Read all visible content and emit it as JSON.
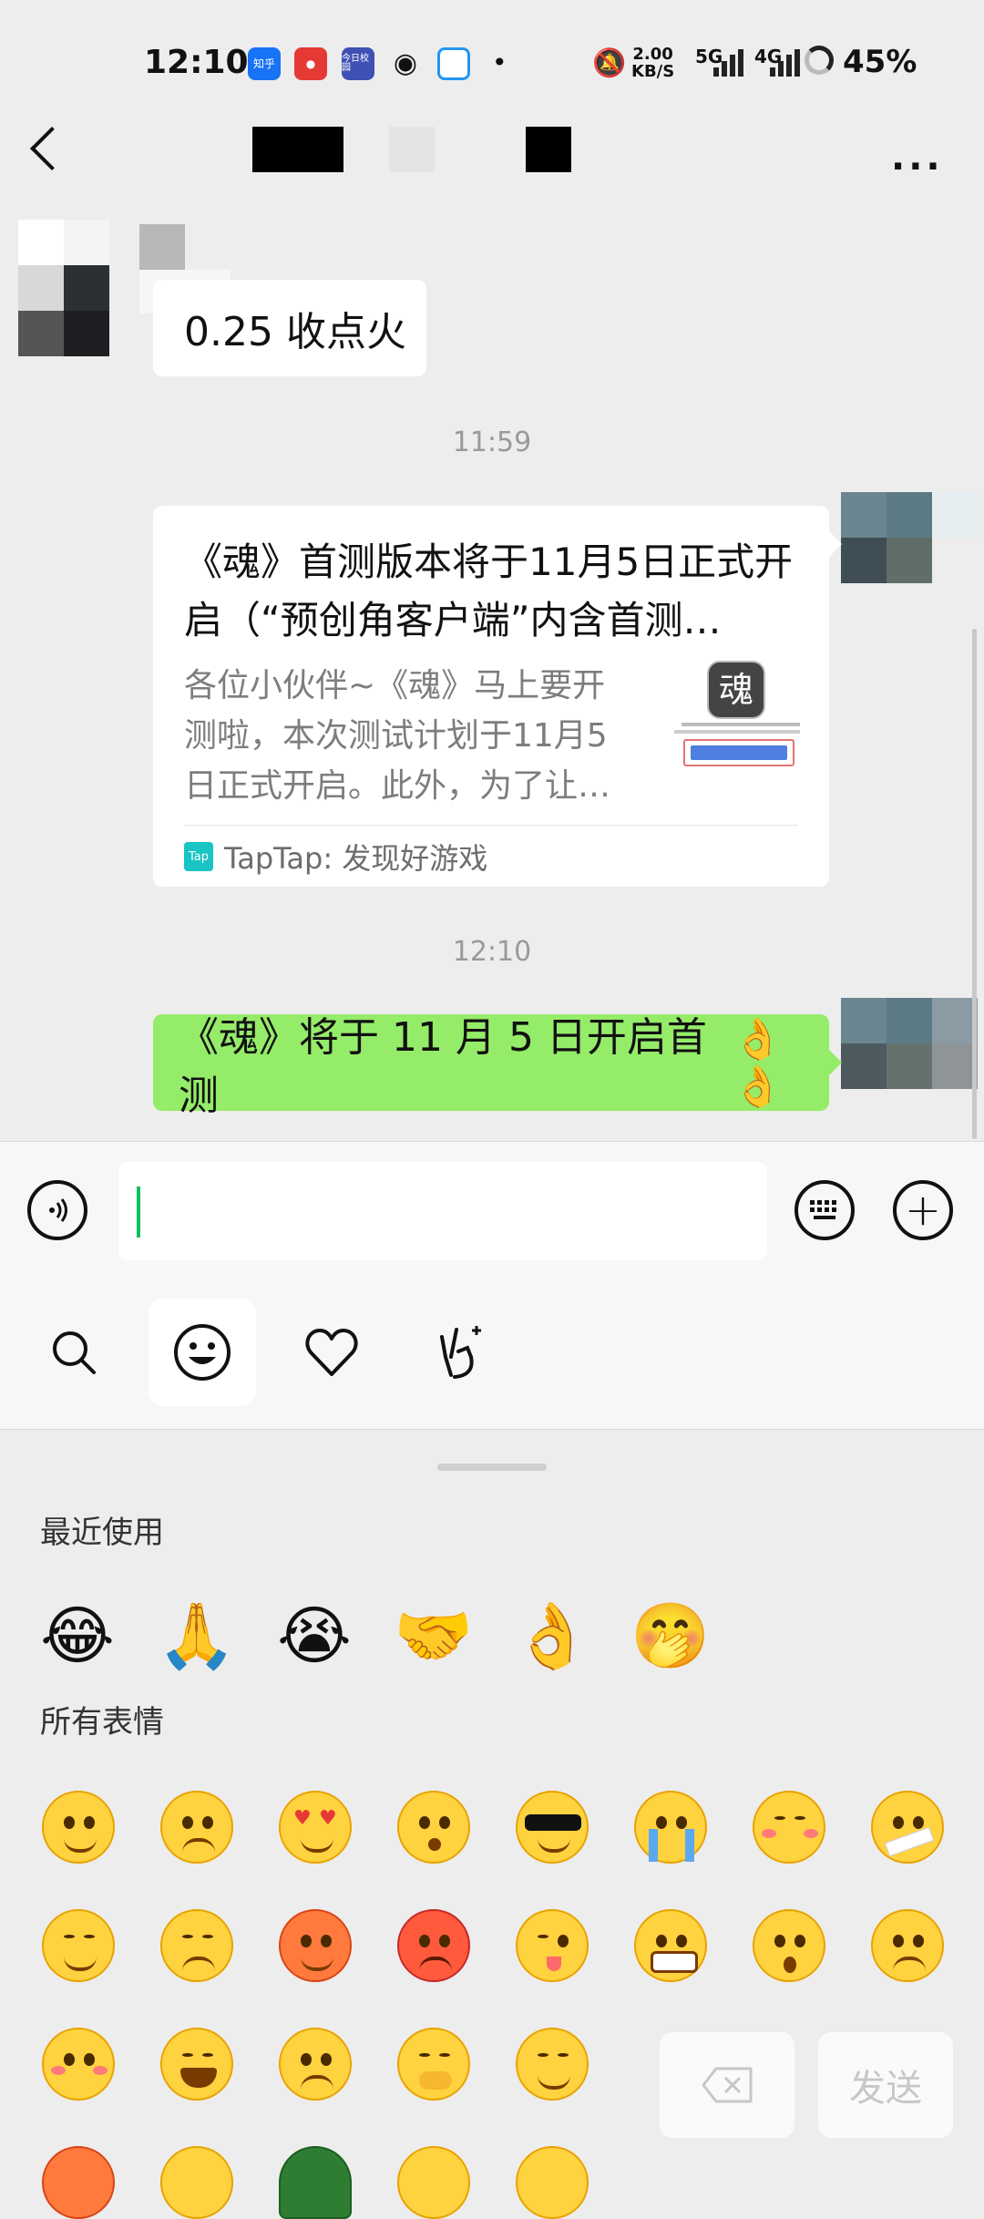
{
  "status_bar": {
    "time": "12:10",
    "apps": [
      {
        "label": "知乎",
        "color": "#1772f6"
      },
      {
        "label": "",
        "color": "#e53935"
      },
      {
        "label": "今日校园",
        "color": "#3f51b5"
      },
      {
        "label": "",
        "color": "#111111"
      },
      {
        "label": "",
        "color": "#2196f3"
      }
    ],
    "net_speed_value": "2.00",
    "net_speed_unit": "KB/S",
    "network_1": "5G",
    "network_2": "4G",
    "battery": "45%"
  },
  "header": {
    "back_icon": "chevron-left-icon",
    "more_icon": "more-dots-icon"
  },
  "chat": {
    "messages": [
      {
        "text": "0.25 收点火"
      },
      {
        "timestamp": "11:59"
      },
      {
        "card_title": "《魂》首测版本将于11月5日正式开启（“预创角客户端”内含首测…",
        "card_desc": "各位小伙伴~《魂》马上要开测啦，本次测试计划于11月5日正式开启。此外，为了让…",
        "card_source": "TapTap: 发现好游戏",
        "source_logo": "Tap"
      },
      {
        "timestamp": "12:10"
      },
      {
        "text": "《魂》将于 11 月 5 日开启首测",
        "emoji": "👌👌"
      }
    ]
  },
  "input": {
    "voice_icon": "voice-icon",
    "value": "",
    "keyboard_icon": "keyboard-icon",
    "plus_icon": "plus-icon"
  },
  "emoji_tabs": [
    {
      "icon": "search-icon",
      "selected": false
    },
    {
      "icon": "smiley-icon",
      "selected": true
    },
    {
      "icon": "heart-icon",
      "selected": false
    },
    {
      "icon": "gesture-icon",
      "selected": false
    }
  ],
  "emoji_panel": {
    "recent_label": "最近使用",
    "recent": [
      "😂",
      "🙏",
      "😭",
      "🤝",
      "👌",
      "🤭"
    ],
    "all_label": "所有表情",
    "delete_icon": "backspace-icon",
    "send_label": "发送"
  },
  "colors": {
    "background": "#ededed",
    "green_bubble": "#95ec69",
    "accent": "#07c160"
  }
}
